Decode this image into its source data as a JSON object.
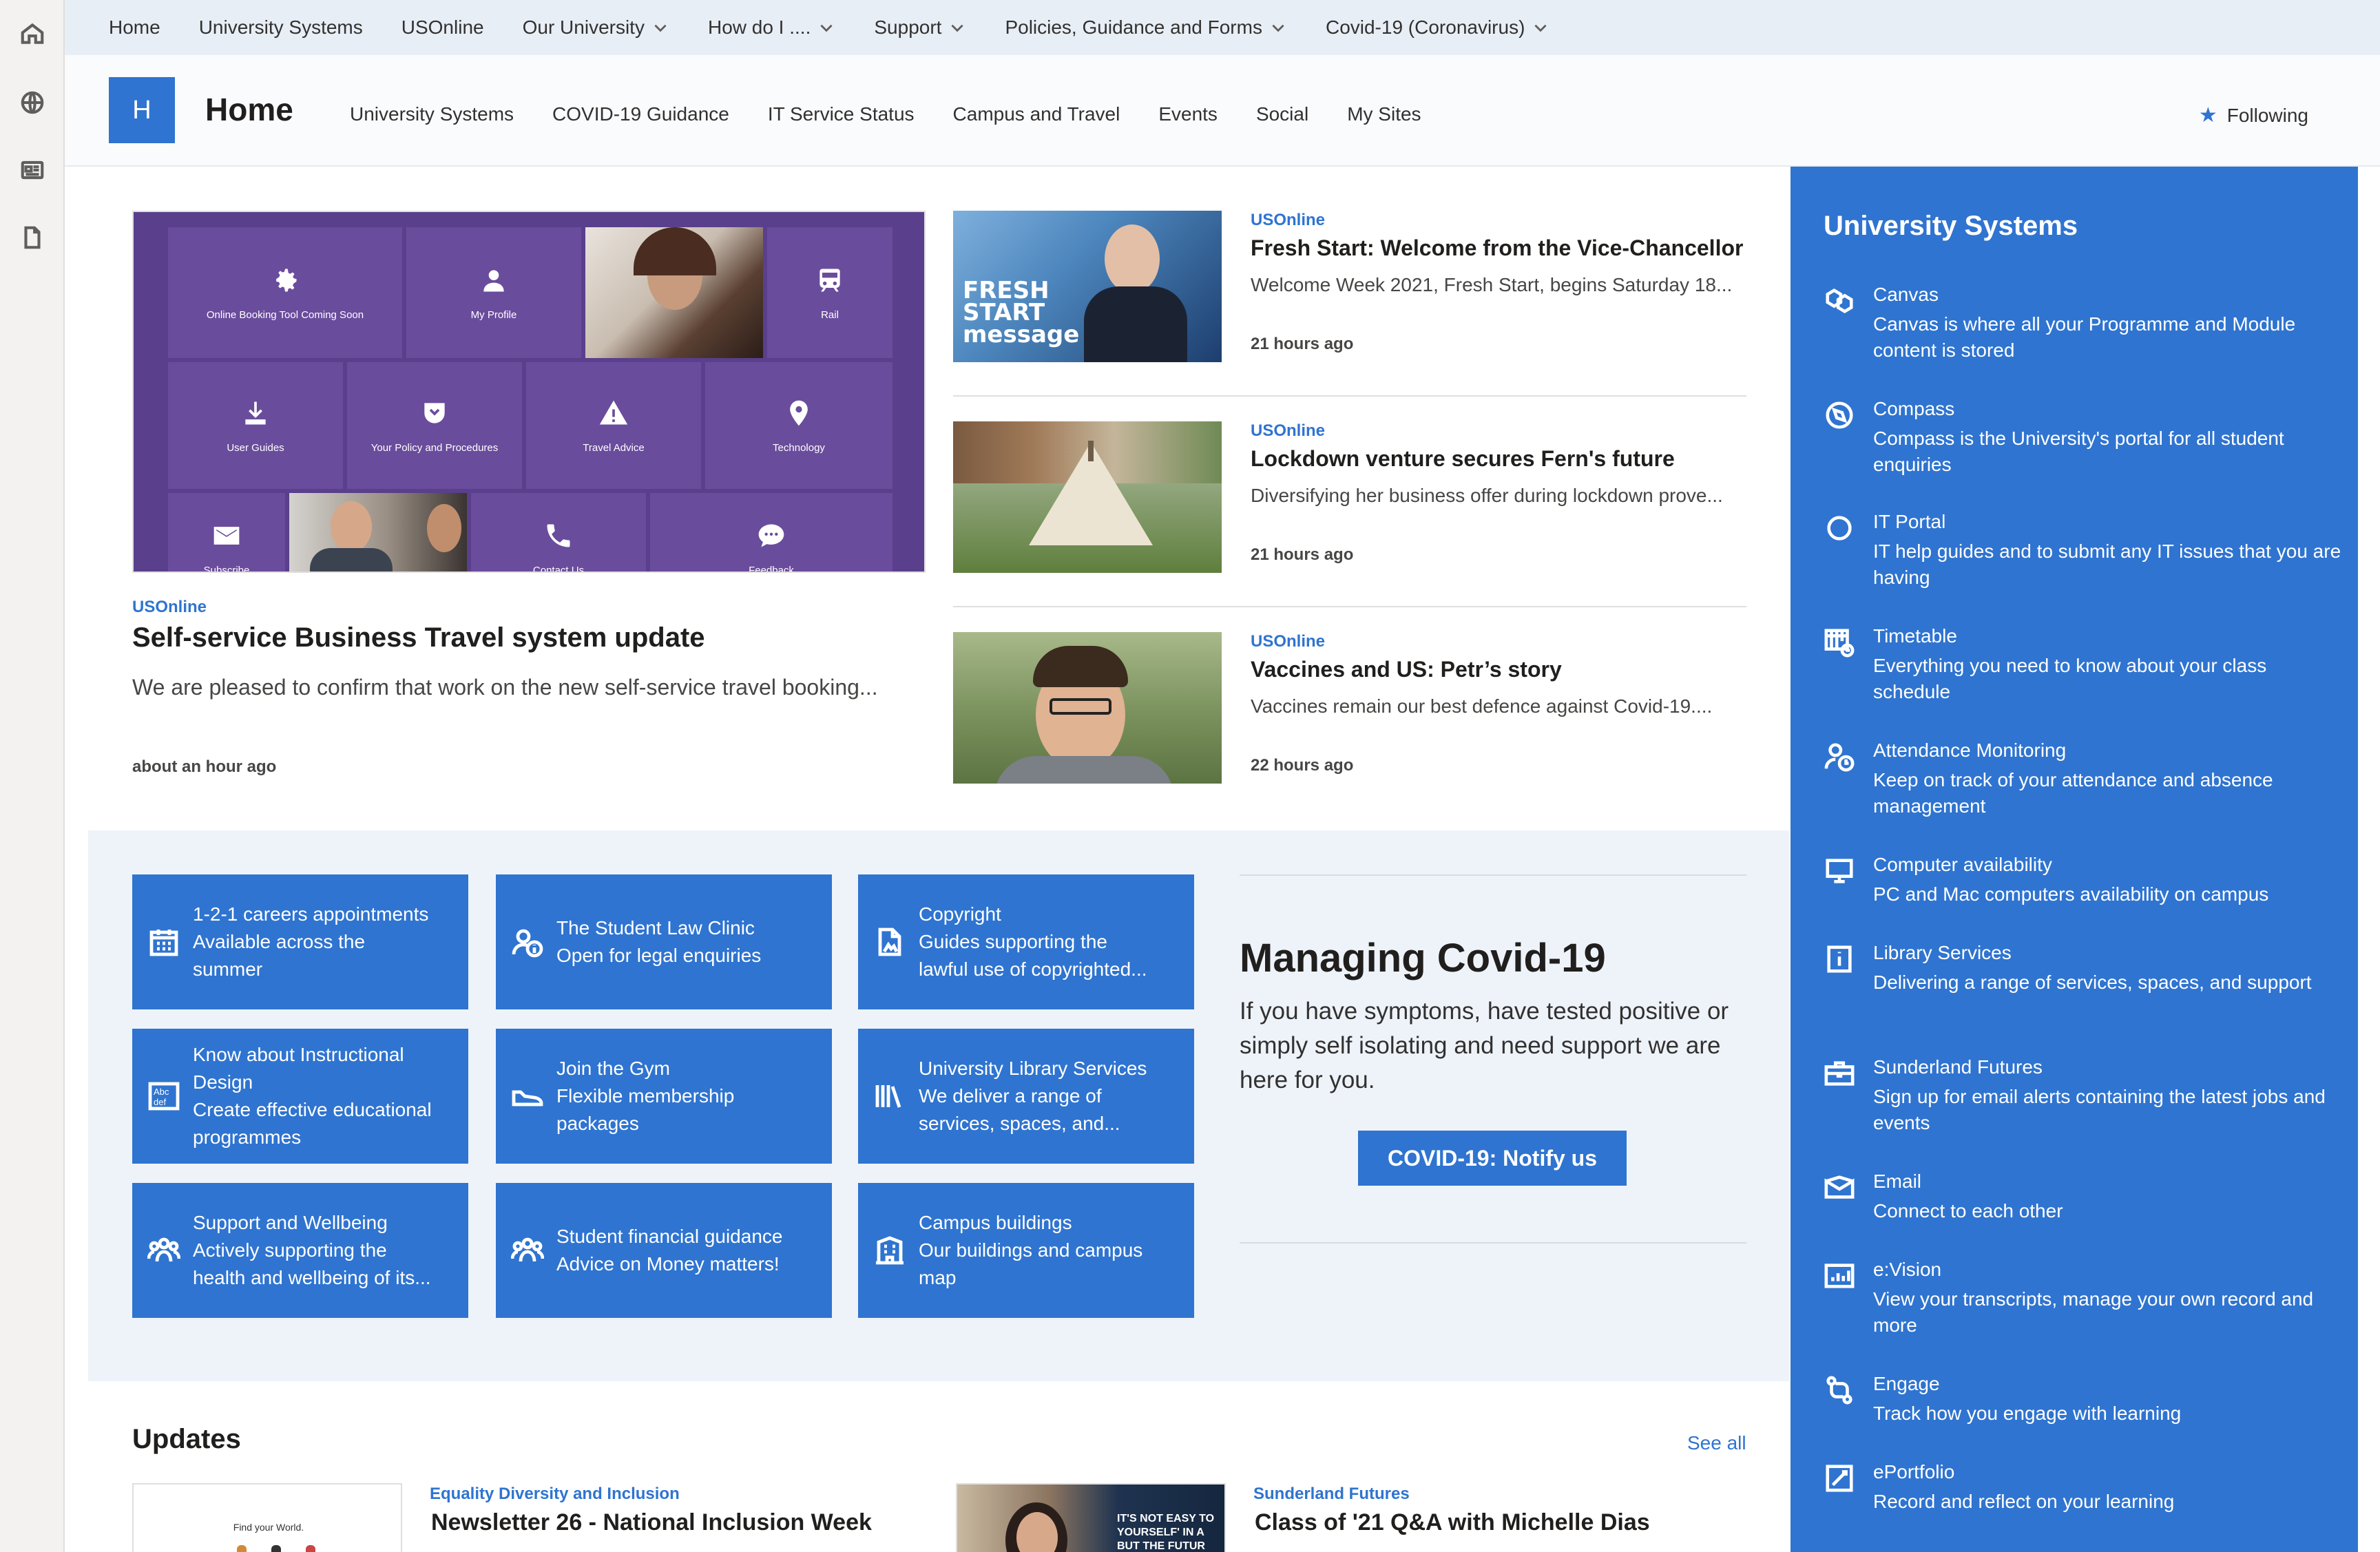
{
  "hub_nav": {
    "items": [
      {
        "label": "Home",
        "has_menu": false
      },
      {
        "label": "University Systems",
        "has_menu": false
      },
      {
        "label": "USOnline",
        "has_menu": false
      },
      {
        "label": "Our University",
        "has_menu": true
      },
      {
        "label": "How do I ....",
        "has_menu": true
      },
      {
        "label": "Support",
        "has_menu": true
      },
      {
        "label": "Policies, Guidance and Forms",
        "has_menu": true
      },
      {
        "label": "Covid-19 (Coronavirus)",
        "has_menu": true
      }
    ]
  },
  "rail": {
    "icons": [
      "home-icon",
      "globe-icon",
      "news-icon",
      "document-icon"
    ]
  },
  "site": {
    "logo_letter": "H",
    "title": "Home",
    "nav": [
      "University Systems",
      "COVID-19 Guidance",
      "IT Service Status",
      "Campus and Travel",
      "Events",
      "Social",
      "My Sites"
    ],
    "following_label": "Following"
  },
  "hero": {
    "source": "USOnline",
    "title": "Self-service Business Travel system update",
    "description": "We are pleased to confirm that work on the new self-service travel booking...",
    "time": "about an hour ago",
    "tiles": {
      "online_booking": "Online Booking Tool Coming Soon",
      "my_profile": "My Profile",
      "rail": "Rail",
      "user_guides": "User Guides",
      "policy": "Your Policy and Procedures",
      "travel_advice": "Travel Advice",
      "technology": "Technology",
      "subscribe": "Subscribe",
      "contact": "Contact Us",
      "feedback": "Feedback"
    }
  },
  "news": [
    {
      "source": "USOnline",
      "title": "Fresh Start: Welcome from the Vice-Chancellor",
      "description": "Welcome Week 2021, Fresh Start, begins Saturday 18...",
      "time": "21 hours ago",
      "thumb_text": "FRESH START message"
    },
    {
      "source": "USOnline",
      "title": "Lockdown venture secures Fern's future",
      "description": "Diversifying her business offer during lockdown prove...",
      "time": "21 hours ago"
    },
    {
      "source": "USOnline",
      "title": "Vaccines and US: Petr’s story",
      "description": "Vaccines remain our best defence against Covid-19....",
      "time": "22 hours ago"
    }
  ],
  "quick_links": [
    {
      "icon": "calendar-icon",
      "lines": [
        "1-2-1 careers appointments",
        "Available across the",
        "summer"
      ]
    },
    {
      "icon": "person-info-icon",
      "lines": [
        "The Student Law Clinic",
        "Open for legal enquiries"
      ]
    },
    {
      "icon": "copyright-doc-icon",
      "lines": [
        "Copyright",
        "Guides supporting the",
        "lawful use of copyrighted..."
      ]
    },
    {
      "icon": "abc-def-icon",
      "lines": [
        "Know about Instructional",
        "Design",
        "Create effective educational",
        "programmes"
      ]
    },
    {
      "icon": "shoe-icon",
      "lines": [
        "Join the Gym",
        "Flexible membership",
        "packages"
      ]
    },
    {
      "icon": "books-icon",
      "lines": [
        "University Library Services",
        "We deliver a range of",
        "services, spaces, and..."
      ]
    },
    {
      "icon": "people-icon",
      "lines": [
        "Support and Wellbeing",
        "Actively supporting the",
        "health and wellbeing of its..."
      ]
    },
    {
      "icon": "people-icon",
      "lines": [
        "Student financial guidance",
        "Advice on Money matters!"
      ]
    },
    {
      "icon": "building-icon",
      "lines": [
        "Campus buildings",
        "Our buildings and campus",
        "map"
      ]
    }
  ],
  "covid": {
    "title": "Managing Covid-19",
    "text": "If you have symptoms, have tested positive or simply self isolating and need support we are here for you.",
    "button": "COVID-19: Notify us"
  },
  "updates": {
    "title": "Updates",
    "see_all": "See all",
    "items": [
      {
        "source": "Equality Diversity and Inclusion",
        "title": "Newsletter 26 - National Inclusion Week",
        "thumb_text": "Find your World."
      },
      {
        "source": "Sunderland Futures",
        "title": "Class of '21 Q&A with Michelle Dias",
        "thumb_text": "IT'S NOT EASY TO YOURSELF' IN A BUT THE FUTUR"
      }
    ]
  },
  "systems": {
    "title": "University Systems",
    "items": [
      {
        "icon": "canvas-icon",
        "name": "Canvas",
        "desc": "Canvas is where all your Programme and Module content is stored"
      },
      {
        "icon": "compass-icon",
        "name": "Compass",
        "desc": "Compass is the University's portal for all student enquiries"
      },
      {
        "icon": "circle-icon",
        "name": "IT Portal",
        "desc": "IT help guides and to submit any IT issues that you are having"
      },
      {
        "icon": "timetable-icon",
        "name": "Timetable",
        "desc": "Everything you need to know about your class schedule"
      },
      {
        "icon": "attendance-icon",
        "name": "Attendance Monitoring",
        "desc": "Keep on track of your attendance and absence management"
      },
      {
        "icon": "computer-icon",
        "name": "Computer availability",
        "desc": "PC and Mac computers availability on campus"
      },
      {
        "icon": "info-icon",
        "name": "Library Services",
        "desc": "Delivering a range of services, spaces, and support"
      },
      {
        "icon": "briefcase-icon",
        "name": "Sunderland Futures",
        "desc": "Sign up for email alerts containing the latest jobs and events"
      },
      {
        "icon": "email-icon",
        "name": "Email",
        "desc": "Connect to each other"
      },
      {
        "icon": "chart-icon",
        "name": "e:Vision",
        "desc": "View your transcripts, manage your own record and more"
      },
      {
        "icon": "engage-icon",
        "name": "Engage",
        "desc": "Track how you engage with learning"
      },
      {
        "icon": "portfolio-icon",
        "name": "ePortfolio",
        "desc": "Record and reflect on your learning"
      }
    ]
  },
  "colors": {
    "accent": "#2f74d0",
    "hub_bg": "#e8eef6",
    "band_bg": "#eef3fa",
    "tile_purple": "#6a4c9c"
  }
}
